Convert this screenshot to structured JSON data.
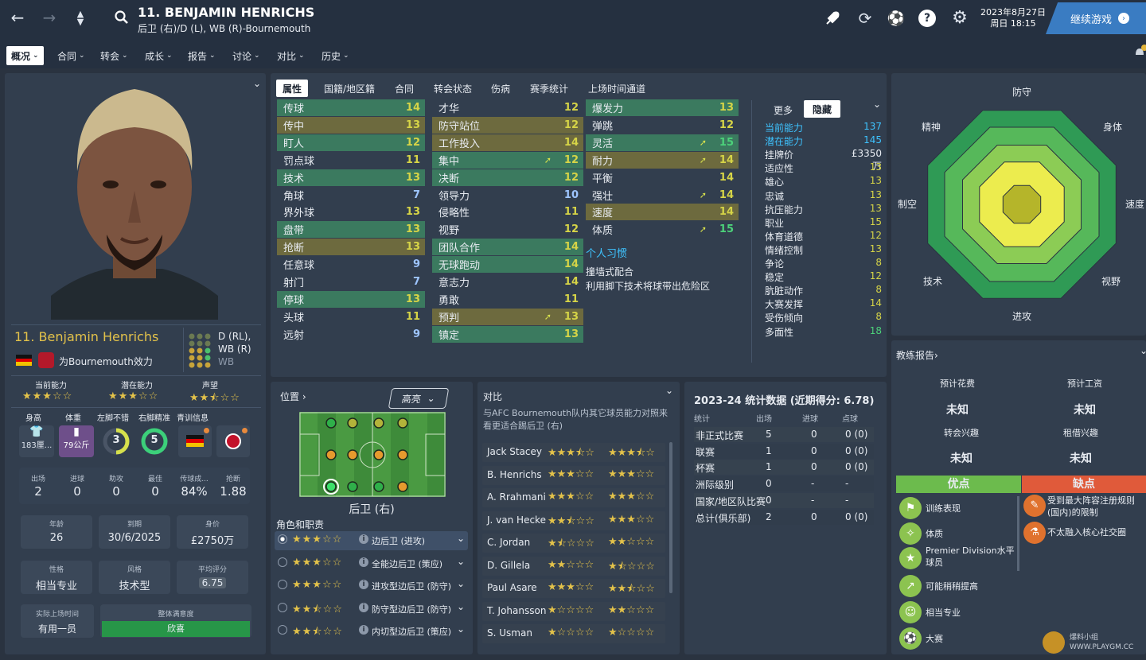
{
  "header": {
    "title": "11. BENJAMIN HENRICHS",
    "subtitle": "后卫 (右)/D (L), WB (R)-Bournemouth",
    "date": "2023年8月27日",
    "weekday": "周日 18:15",
    "continue": "继续游戏"
  },
  "nav": [
    "概况",
    "合同",
    "转会",
    "成长",
    "报告",
    "讨论",
    "对比",
    "历史"
  ],
  "profile": {
    "name": "11. Benjamin Henrichs",
    "club": "为Bournemouth效力",
    "positions": [
      "D (RL),",
      "WB (R)",
      "WB"
    ],
    "ratings": [
      {
        "label": "当前能力",
        "stars": 3
      },
      {
        "label": "潜在能力",
        "stars": 3
      },
      {
        "label": "声望",
        "stars": 2.5
      }
    ],
    "phys_labels": [
      "身高",
      "体重",
      "左脚不错",
      "右脚精准",
      "青训信息"
    ],
    "height": "183厘...",
    "weight": "79公斤",
    "left_foot": "3",
    "right_foot": "5",
    "stats": [
      {
        "label": "出场",
        "value": "2"
      },
      {
        "label": "进球",
        "value": "0"
      },
      {
        "label": "助攻",
        "value": "0"
      },
      {
        "label": "最佳",
        "value": "0"
      },
      {
        "label": "传球成...",
        "value": "84%"
      },
      {
        "label": "抢断",
        "value": "1.88"
      }
    ],
    "info": [
      {
        "label": "年龄",
        "value": "26"
      },
      {
        "label": "到期",
        "value": "30/6/2025"
      },
      {
        "label": "身价",
        "value": "£2750万"
      }
    ],
    "traits": [
      {
        "label": "性格",
        "value": "相当专业"
      },
      {
        "label": "风格",
        "value": "技术型"
      },
      {
        "label": "平均评分",
        "value": "6.75"
      }
    ],
    "playing_time": {
      "label": "实际上场时间",
      "value": "有用一员"
    },
    "satisfaction": {
      "label": "整体满意度",
      "value": "欣喜"
    }
  },
  "tabs": [
    "属性",
    "国籍/地区籍",
    "合同",
    "转会状态",
    "伤病",
    "赛季统计",
    "上场时间通道"
  ],
  "attrs_col1": [
    {
      "n": "传球",
      "v": "14",
      "h": "g"
    },
    {
      "n": "传中",
      "v": "13",
      "h": "y"
    },
    {
      "n": "盯人",
      "v": "12",
      "h": "g"
    },
    {
      "n": "罚点球",
      "v": "11",
      "h": ""
    },
    {
      "n": "技术",
      "v": "13",
      "h": "g"
    },
    {
      "n": "角球",
      "v": "7",
      "h": ""
    },
    {
      "n": "界外球",
      "v": "13",
      "h": ""
    },
    {
      "n": "盘带",
      "v": "13",
      "h": "g"
    },
    {
      "n": "抢断",
      "v": "13",
      "h": "y"
    },
    {
      "n": "任意球",
      "v": "9",
      "h": ""
    },
    {
      "n": "射门",
      "v": "7",
      "h": ""
    },
    {
      "n": "停球",
      "v": "13",
      "h": "g"
    },
    {
      "n": "头球",
      "v": "11",
      "h": ""
    },
    {
      "n": "远射",
      "v": "9",
      "h": ""
    }
  ],
  "attrs_col2": [
    {
      "n": "才华",
      "v": "12",
      "h": ""
    },
    {
      "n": "防守站位",
      "v": "12",
      "h": "y"
    },
    {
      "n": "工作投入",
      "v": "14",
      "h": "y"
    },
    {
      "n": "集中",
      "v": "12",
      "h": "g",
      "up": true
    },
    {
      "n": "决断",
      "v": "12",
      "h": "g"
    },
    {
      "n": "领导力",
      "v": "10",
      "h": ""
    },
    {
      "n": "侵略性",
      "v": "11",
      "h": ""
    },
    {
      "n": "视野",
      "v": "12",
      "h": ""
    },
    {
      "n": "团队合作",
      "v": "14",
      "h": "g"
    },
    {
      "n": "无球跑动",
      "v": "14",
      "h": "g"
    },
    {
      "n": "意志力",
      "v": "14",
      "h": ""
    },
    {
      "n": "勇敢",
      "v": "11",
      "h": ""
    },
    {
      "n": "预判",
      "v": "13",
      "h": "y",
      "up": true
    },
    {
      "n": "镇定",
      "v": "13",
      "h": "g"
    }
  ],
  "attrs_col3": [
    {
      "n": "爆发力",
      "v": "13",
      "h": "g"
    },
    {
      "n": "弹跳",
      "v": "12",
      "h": ""
    },
    {
      "n": "灵活",
      "v": "15",
      "h": "g",
      "up": true
    },
    {
      "n": "耐力",
      "v": "14",
      "h": "y",
      "up": true
    },
    {
      "n": "平衡",
      "v": "14",
      "h": ""
    },
    {
      "n": "强壮",
      "v": "14",
      "h": "",
      "up": true
    },
    {
      "n": "速度",
      "v": "14",
      "h": "y"
    },
    {
      "n": "体质",
      "v": "15",
      "h": "",
      "up": true
    }
  ],
  "habits": {
    "title": "个人习惯",
    "items": [
      "撞墙式配合",
      "利用脚下技术将球带出危险区"
    ]
  },
  "hidden": {
    "more": "更多",
    "hide": "隐藏",
    "rows": [
      {
        "l": "当前能力",
        "v": "137",
        "c": "#3ec3ff"
      },
      {
        "l": "潜在能力",
        "v": "145",
        "c": "#3ec3ff"
      },
      {
        "l": "挂牌价",
        "v": "£3350万",
        "c": "#e8ecf2"
      },
      {
        "l": "适应性",
        "v": "13"
      },
      {
        "l": "雄心",
        "v": "13"
      },
      {
        "l": "忠诚",
        "v": "13"
      },
      {
        "l": "抗压能力",
        "v": "13"
      },
      {
        "l": "职业",
        "v": "15"
      },
      {
        "l": "体育道德",
        "v": "12"
      },
      {
        "l": "情绪控制",
        "v": "13"
      },
      {
        "l": "争论",
        "v": "8"
      },
      {
        "l": "稳定",
        "v": "12"
      },
      {
        "l": "肮脏动作",
        "v": "8"
      },
      {
        "l": "大赛发挥",
        "v": "14"
      },
      {
        "l": "受伤倾向",
        "v": "8"
      },
      {
        "l": "多面性",
        "v": "18",
        "c": "#4cd17a"
      }
    ]
  },
  "radar": {
    "labels": [
      "防守",
      "身体",
      "速度",
      "视野",
      "进攻",
      "技术",
      "制空",
      "精神"
    ]
  },
  "position": {
    "title": "位置",
    "highlight": "高亮",
    "pos_name": "后卫 (右)",
    "roles_title": "角色和职责",
    "roles": [
      {
        "name": "边后卫 (进攻)",
        "stars": 3
      },
      {
        "name": "全能边后卫 (策应)",
        "stars": 3
      },
      {
        "name": "进攻型边后卫 (防守)",
        "stars": 3
      },
      {
        "name": "防守型边后卫 (防守)",
        "stars": 2.5
      },
      {
        "name": "内切型边后卫 (策应)",
        "stars": 2.5
      }
    ]
  },
  "compare": {
    "title": "对比",
    "desc": "与AFC Bournemouth队内其它球员能力对照来看更适合踢后卫 (右)",
    "rows": [
      {
        "n": "Jack Stacey",
        "a": 3.5,
        "b": 3.5
      },
      {
        "n": "B. Henrichs",
        "a": 3,
        "b": 3
      },
      {
        "n": "A. Rrahmani",
        "a": 3,
        "b": 3
      },
      {
        "n": "J. van Hecke",
        "a": 2.5,
        "b": 3
      },
      {
        "n": "C. Jordan",
        "a": 1.5,
        "b": 2
      },
      {
        "n": "D. Gillela",
        "a": 2,
        "b": 1.5
      },
      {
        "n": "Paul Asare",
        "a": 3,
        "b": 2.5
      },
      {
        "n": "T. Johansson",
        "a": 1,
        "b": 2
      },
      {
        "n": "S. Usman",
        "a": 1,
        "b": 1
      }
    ]
  },
  "season": {
    "title": "2023-24 统计数据 (近期得分: 6.78)",
    "cols": [
      "统计",
      "出场",
      "进球",
      "点球"
    ],
    "rows": [
      {
        "c": "非正式比赛",
        "a": "5",
        "g": "0",
        "p": "0 (0)"
      },
      {
        "c": "联赛",
        "a": "1",
        "g": "0",
        "p": "0 (0)"
      },
      {
        "c": "杯赛",
        "a": "1",
        "g": "0",
        "p": "0 (0)"
      },
      {
        "c": "洲际级别",
        "a": "0",
        "g": "-",
        "p": "-"
      },
      {
        "c": "国家/地区队比赛",
        "a": "0",
        "g": "-",
        "p": "-"
      },
      {
        "c": "总计(俱乐部)",
        "a": "2",
        "g": "0",
        "p": "0 (0)"
      }
    ]
  },
  "coach": {
    "title": "教练报告",
    "fee_label": "预计花费",
    "fee": "未知",
    "wage_label": "预计工资",
    "wage": "未知",
    "transfer_label": "转会兴趣",
    "transfer": "未知",
    "loan_label": "租借兴趣",
    "loan": "未知",
    "pros_title": "优点",
    "cons_title": "缺点",
    "pros": [
      "训练表现",
      "体质",
      "Premier Division水平球员",
      "可能稍稍提高",
      "相当专业",
      "大赛"
    ],
    "cons": [
      "受到最大阵容注册规则(国内)的限制",
      "不太融入核心社交圈"
    ]
  },
  "watermark": "爆料小组 WWW.PLAYGM.CC"
}
